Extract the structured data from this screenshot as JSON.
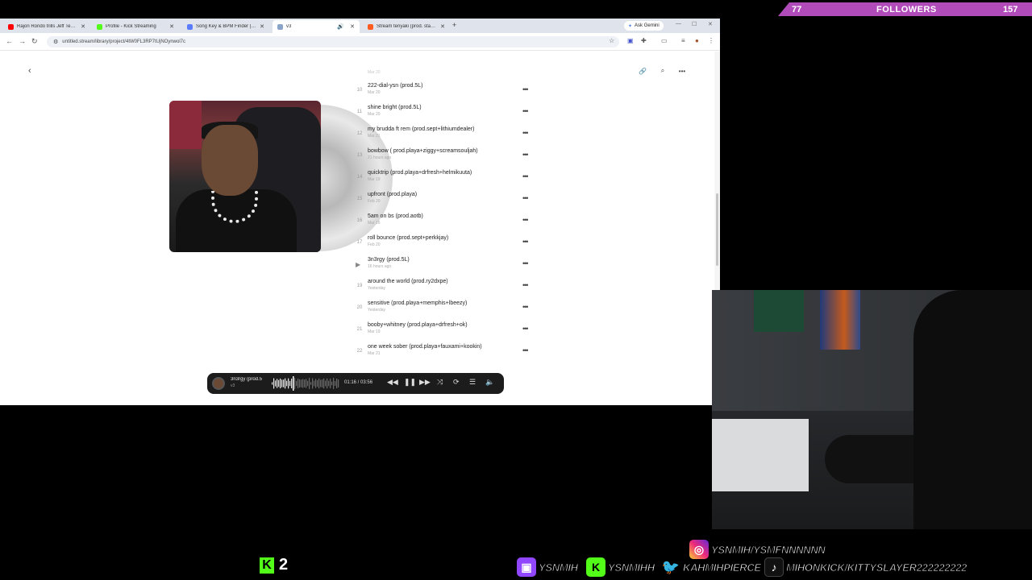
{
  "browser": {
    "tabs": [
      {
        "label": "Rajon Rondo trills Jeff Teague a",
        "color": "#ff0000"
      },
      {
        "label": "Profile - Kick Streaming",
        "color": "#53fc18"
      },
      {
        "label": "Song Key & BPM Finder | Tuno",
        "color": "#5b7cff"
      },
      {
        "label": "v3",
        "color": "#8aa4c8"
      },
      {
        "label": "Stream teriyaki (prod. stang 8i",
        "color": "#ff5a1f"
      }
    ],
    "new_tab": "+",
    "ask_gemini": "Ask Gemini",
    "url": "untitled.stream/library/project/4tW0FL3RP7tUjNOynwol7c"
  },
  "page": {
    "faded_row": "Mar 20",
    "tracks": [
      {
        "num": "10",
        "title": "222-dial-ysn (prod.5L)",
        "date": "Mar 20"
      },
      {
        "num": "11",
        "title": "shine bright (prod.5L)",
        "date": "Mar 20"
      },
      {
        "num": "12",
        "title": "my brudda ft rem (prod.sept+lithiumdealer)",
        "date": "Mar 21"
      },
      {
        "num": "13",
        "title": "bowbow ( prod.playa+ziggy+screamsouljah)",
        "date": "21 hours ago"
      },
      {
        "num": "14",
        "title": "quicktrip (prod.playa+drfresh+helmikuuta)",
        "date": "Mar 19"
      },
      {
        "num": "15",
        "title": "upfront (prod.playa)",
        "date": "Feb 20"
      },
      {
        "num": "16",
        "title": "5am on bs (prod.aotb)",
        "date": "Mar 16"
      },
      {
        "num": "17",
        "title": "roll bounce (prod.sept+perkkjay)",
        "date": "Feb 20"
      },
      {
        "num": "",
        "title": "3n3rgy (prod.5L)",
        "date": "16 hours ago",
        "playing": true
      },
      {
        "num": "19",
        "title": "around the world (prod.ry2dxpe)",
        "date": "Yesterday"
      },
      {
        "num": "20",
        "title": "sensitive (prod.playa+memphis+lbeezy)",
        "date": "Yesterday"
      },
      {
        "num": "21",
        "title": "booby+whitney (prod.playa+drfresh+ok)",
        "date": "Mar 19"
      },
      {
        "num": "22",
        "title": "one week sober (prod.playa+fauxami+kookin)",
        "date": "Mar 21"
      }
    ],
    "more": "•••"
  },
  "player": {
    "title": "3n3rgy (prod.5",
    "subtitle": "v3",
    "time": "01:16 / 03:56",
    "progress": 0.32
  },
  "overlay": {
    "followers_count": "77",
    "followers_label": "FOLLOWERS",
    "followers_goal": "157",
    "kick_viewers": "2",
    "socials": [
      {
        "platform": "instagram",
        "handle": "YSNMIH/YSMFNNNNNN",
        "color": "#d6249f"
      },
      {
        "platform": "twitch",
        "handle": "YSNMIH",
        "color": "#9146ff"
      },
      {
        "platform": "kick",
        "handle": "YSNMIHH",
        "color": "#53fc18"
      },
      {
        "platform": "twitter",
        "handle": "KAHMIHPIERCE",
        "color": "#1da1f2"
      },
      {
        "platform": "tiktok",
        "handle": "MIHONKICK/KITTYSLAYER222222222",
        "color": "#111111"
      }
    ]
  }
}
